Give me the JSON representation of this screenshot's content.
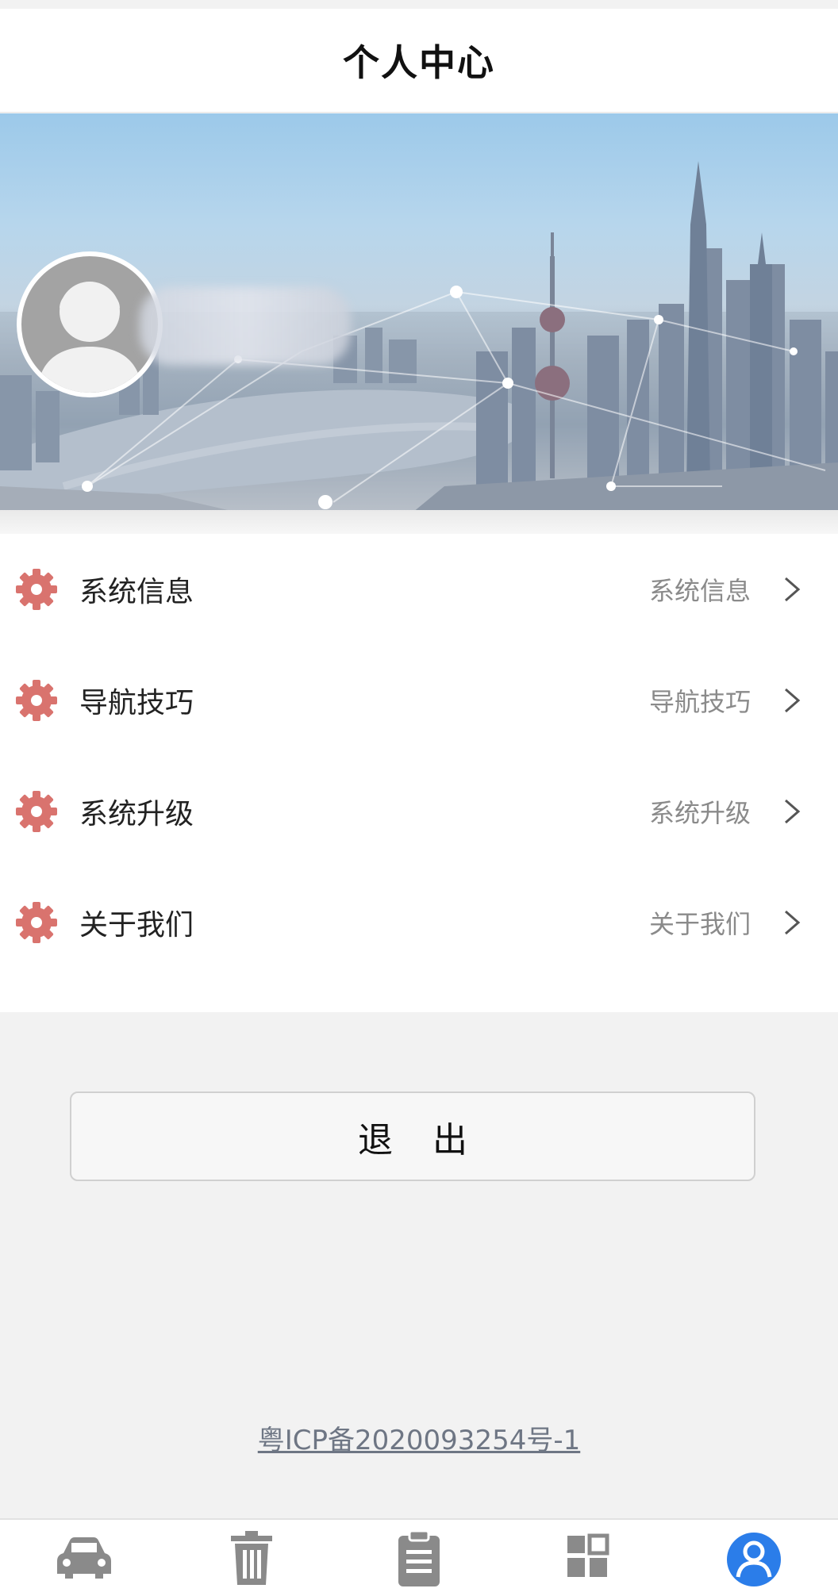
{
  "header": {
    "title": "个人中心"
  },
  "profile": {
    "username": ""
  },
  "menu": {
    "items": [
      {
        "label": "系统信息",
        "value": "系统信息",
        "icon": "gear-icon"
      },
      {
        "label": "导航技巧",
        "value": "导航技巧",
        "icon": "gear-icon"
      },
      {
        "label": "系统升级",
        "value": "系统升级",
        "icon": "gear-icon"
      },
      {
        "label": "关于我们",
        "value": "关于我们",
        "icon": "gear-icon"
      }
    ]
  },
  "logout": {
    "label": "退 出"
  },
  "footer": {
    "icp": "粤ICP备2020093254号-1"
  },
  "tabbar": {
    "items": [
      {
        "label": "",
        "icon": "car-icon"
      },
      {
        "label": "",
        "icon": "trash-icon"
      },
      {
        "label": "",
        "icon": "clipboard-icon"
      },
      {
        "label": "",
        "icon": "grid-icon"
      },
      {
        "label": "",
        "icon": "user-icon",
        "active": true
      }
    ]
  },
  "colors": {
    "accent": "#2b7de9",
    "gear": "#d9736e",
    "inactive_icon": "#8a8a8a"
  }
}
